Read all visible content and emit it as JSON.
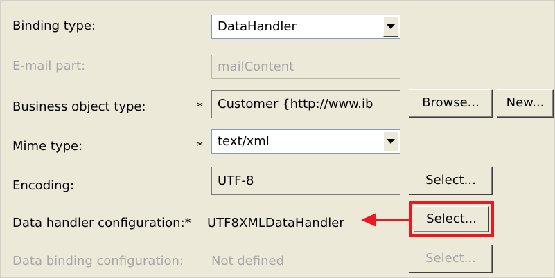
{
  "form": {
    "binding_type": {
      "label": "Binding type:",
      "value": "DataHandler"
    },
    "email_part": {
      "label": "E-mail part:",
      "value": "mailContent"
    },
    "business_object_type": {
      "label": "Business object type:",
      "required": "*",
      "value": "Customer  {http://www.ib",
      "browse_label": "Browse...",
      "new_label": "New..."
    },
    "mime_type": {
      "label": "Mime type:",
      "required": "*",
      "value": "text/xml"
    },
    "encoding": {
      "label": "Encoding:",
      "value": "UTF-8",
      "select_label": "Select..."
    },
    "data_handler": {
      "label": "Data handler configuration:*",
      "value": "UTF8XMLDataHandler",
      "select_label": "Select..."
    },
    "data_binding": {
      "label": "Data binding configuration:",
      "value": "Not defined",
      "select_label": "Select..."
    }
  },
  "annotation": {
    "color": "#e8191f"
  }
}
